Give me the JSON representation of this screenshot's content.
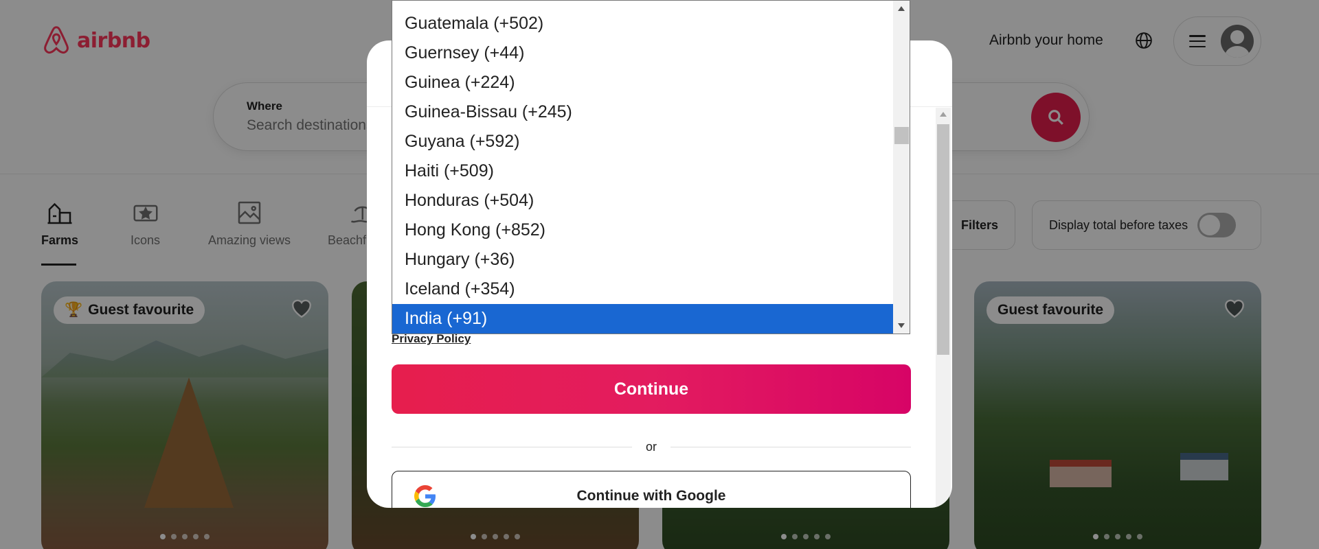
{
  "header": {
    "logo_text": "airbnb",
    "brand_color": "#ff385c",
    "host_link": "Airbnb your home",
    "globe_icon": "globe-icon",
    "menu_icon": "hamburger-menu-icon",
    "avatar_icon": "user-avatar-icon"
  },
  "search": {
    "where_label": "Where",
    "where_placeholder": "Search destinations",
    "search_icon": "search-icon"
  },
  "categories": [
    {
      "label": "Farms",
      "icon": "farm-icon",
      "active": true
    },
    {
      "label": "Icons",
      "icon": "ticket-star-icon",
      "active": false
    },
    {
      "label": "Amazing views",
      "icon": "picture-frame-icon",
      "active": false
    },
    {
      "label": "Beachfront",
      "icon": "beach-icon",
      "active": false
    }
  ],
  "filters": {
    "filters_label": "Filters",
    "taxes_label": "Display total before taxes",
    "taxes_toggle_on": false
  },
  "cards": [
    {
      "badge": "Guest favourite",
      "badge_icon": "trophy-icon",
      "dots": 5
    },
    {
      "badge": "",
      "dots": 5
    },
    {
      "badge": "",
      "dots": 5
    },
    {
      "badge": "Guest favourite",
      "dots": 5
    }
  ],
  "modal": {
    "privacy_link": "Privacy Policy",
    "continue_label": "Continue",
    "continue_color": "#e61e4d",
    "or_text": "or",
    "google_label": "Continue with Google",
    "google_icon": "google-g-icon"
  },
  "country_dropdown": {
    "options": [
      "Guatemala (+502)",
      "Guernsey (+44)",
      "Guinea (+224)",
      "Guinea-Bissau (+245)",
      "Guyana (+592)",
      "Haiti (+509)",
      "Honduras (+504)",
      "Hong Kong (+852)",
      "Hungary (+36)",
      "Iceland (+354)",
      "India (+91)"
    ],
    "selected": "India (+91)",
    "selected_color": "#1967d2"
  }
}
